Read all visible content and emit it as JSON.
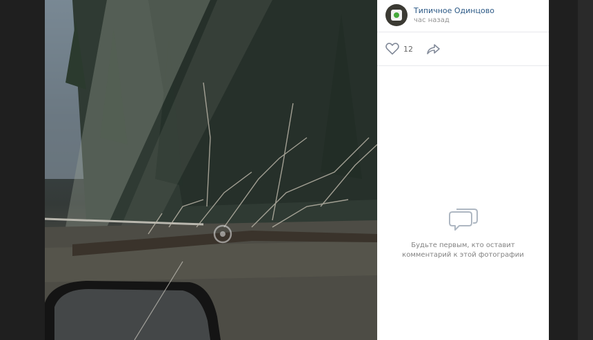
{
  "post": {
    "author": "Типичное Одинцово",
    "time_ago": "час назад"
  },
  "actions": {
    "likes_count": "12"
  },
  "comments": {
    "empty_text": "Будьте первым, кто оставит комментарий к этой фотографии"
  },
  "icons": {
    "like": "heart-icon",
    "share": "share-arrow-icon",
    "comments_empty": "speech-bubbles-icon"
  },
  "colors": {
    "link": "#2a5885",
    "muted": "#939393",
    "icon": "#828a99",
    "background": "#202020"
  }
}
